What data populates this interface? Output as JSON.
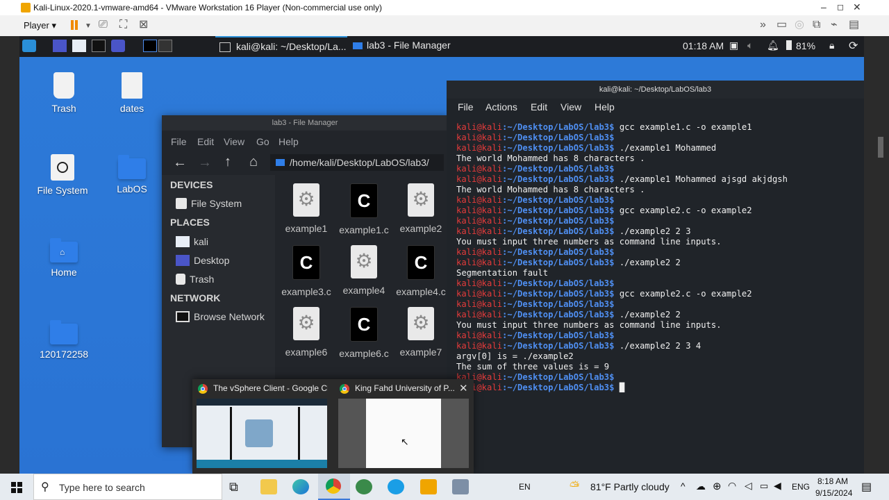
{
  "vmware": {
    "title": "Kali-Linux-2020.1-vmware-amd64 - VMware Workstation 16 Player (Non-commercial use only)",
    "player_label": "Player"
  },
  "kali_panel": {
    "task_terminal": "kali@kali: ~/Desktop/La...",
    "task_filemanager": "lab3 - File Manager",
    "clock": "01:18 AM",
    "battery": "81%"
  },
  "desktop_icons": [
    {
      "label": "Trash"
    },
    {
      "label": "dates"
    },
    {
      "label": "File System"
    },
    {
      "label": "LabOS"
    },
    {
      "label": "Home"
    },
    {
      "label": "120172258"
    }
  ],
  "file_manager": {
    "title": "lab3 - File Manager",
    "menu": [
      "File",
      "Edit",
      "View",
      "Go",
      "Help"
    ],
    "path": "/home/kali/Desktop/LabOS/lab3/",
    "sections": {
      "devices": "DEVICES",
      "places": "PLACES",
      "network": "NETWORK"
    },
    "devices": [
      "File System"
    ],
    "places": [
      "kali",
      "Desktop",
      "Trash"
    ],
    "network": [
      "Browse Network"
    ],
    "files": [
      "example1",
      "example1.c",
      "example2",
      "example3.c",
      "example4",
      "example4.c",
      "example6",
      "example6.c",
      "example7"
    ]
  },
  "terminal": {
    "title": "kali@kali: ~/Desktop/LabOS/lab3",
    "menu": [
      "File",
      "Actions",
      "Edit",
      "View",
      "Help"
    ],
    "prompt_user": "kali@kali",
    "prompt_path": ":~/Desktop/LabOS/lab3$",
    "lines": [
      {
        "type": "cmd",
        "text": " gcc example1.c -o example1"
      },
      {
        "type": "cmd",
        "text": ""
      },
      {
        "type": "cmd",
        "text": " ./example1 Mohammed"
      },
      {
        "type": "out",
        "text": "The world Mohammed has 8 characters ."
      },
      {
        "type": "cmd",
        "text": ""
      },
      {
        "type": "cmd",
        "text": " ./example1 Mohammed ajsgd akjdgsh"
      },
      {
        "type": "out",
        "text": "The world Mohammed has 8 characters ."
      },
      {
        "type": "cmd",
        "text": ""
      },
      {
        "type": "cmd",
        "text": " gcc example2.c -o example2"
      },
      {
        "type": "cmd",
        "text": ""
      },
      {
        "type": "cmd",
        "text": " ./example2 2 3"
      },
      {
        "type": "out",
        "text": "You must input three numbers as command line inputs."
      },
      {
        "type": "cmd",
        "text": ""
      },
      {
        "type": "cmd",
        "text": " ./example2 2"
      },
      {
        "type": "out",
        "text": "Segmentation fault"
      },
      {
        "type": "cmd",
        "text": ""
      },
      {
        "type": "cmd",
        "text": " gcc example2.c -o example2"
      },
      {
        "type": "cmd",
        "text": ""
      },
      {
        "type": "cmd",
        "text": " ./example2 2"
      },
      {
        "type": "out",
        "text": "You must input three numbers as command line inputs."
      },
      {
        "type": "cmd",
        "text": ""
      },
      {
        "type": "cmd",
        "text": " ./example2 2 3 4"
      },
      {
        "type": "out",
        "text": "argv[0] is = ./example2"
      },
      {
        "type": "out",
        "text": "The sum of three values is = 9"
      },
      {
        "type": "cmd",
        "text": ""
      },
      {
        "type": "cmd",
        "text": " █"
      }
    ]
  },
  "thumbnails": [
    {
      "title": "The vSphere Client - Google Ch..."
    },
    {
      "title": "King Fahd University of P..."
    }
  ],
  "taskbar": {
    "search_placeholder": "Type here to search",
    "lang": "EN",
    "weather": "81°F  Partly cloudy",
    "ime": "ENG",
    "time": "8:18 AM",
    "date": "9/15/2024"
  }
}
